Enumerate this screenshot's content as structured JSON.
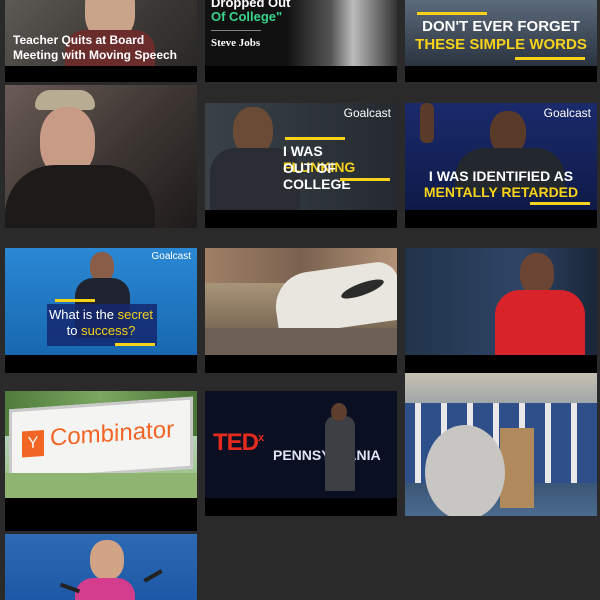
{
  "tiles": [
    {
      "id": "teacher",
      "title": "Teacher Quits at Board Meeting with Moving Speech",
      "line1": "Teacher Quits at Board",
      "line2": "Meeting with Moving Speech"
    },
    {
      "id": "jobs",
      "quote_line1": "Dropped Out",
      "quote_line2": "Of College\"",
      "speaker": "Steve Jobs"
    },
    {
      "id": "forget",
      "line1": "DON'T EVER FORGET",
      "line2": "THESE SIMPLE WORDS"
    },
    {
      "id": "oldman"
    },
    {
      "id": "denzel",
      "brand": "Goalcast",
      "line1_pre": "I WAS ",
      "line1_hl": "FLUNKING",
      "line2": "OUT OF COLLEGE"
    },
    {
      "id": "speaker",
      "brand": "Goalcast",
      "line1": "I WAS IDENTIFIED AS",
      "line2": "MENTALLY RETARDED"
    },
    {
      "id": "secret",
      "brand": "Goalcast",
      "line1_pre": "What is the ",
      "line1_hl": "secret",
      "line2_pre": "to ",
      "line2_hl": "success?"
    },
    {
      "id": "shoes"
    },
    {
      "id": "woman"
    },
    {
      "id": "yc",
      "sign_mark": "Y",
      "sign_text": "Combinator"
    },
    {
      "id": "tedx",
      "ted": "TED",
      "x": "x",
      "event": "PENNSYLVANIA"
    },
    {
      "id": "graduation"
    },
    {
      "id": "greta"
    }
  ],
  "colors": {
    "accent_yellow": "#f6d21b",
    "goalcast_bg": "#1b2a6b",
    "yc_orange": "#f26625",
    "ted_red": "#e62b1e"
  }
}
